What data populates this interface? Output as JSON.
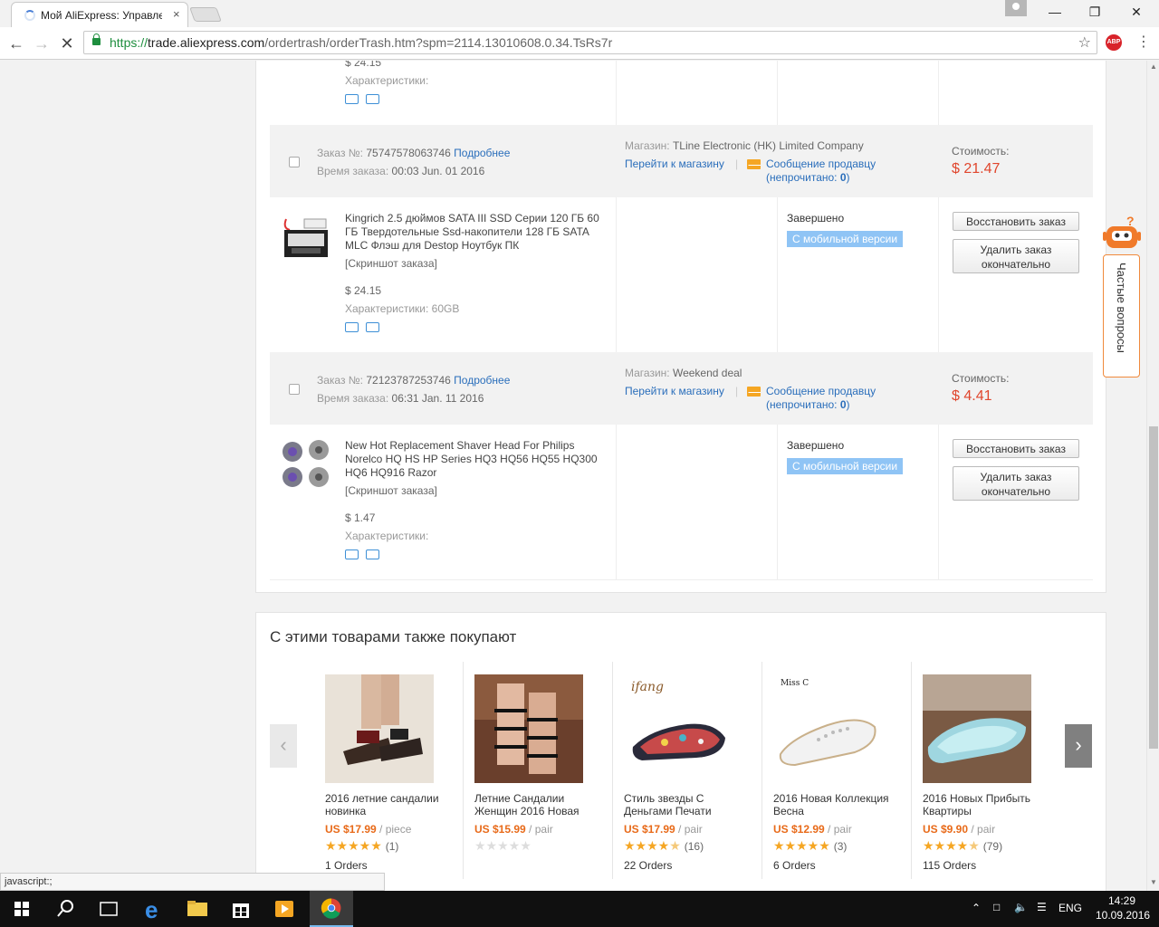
{
  "browser": {
    "tab_title": "Мой AliExpress: Управле",
    "tab_close": "×",
    "url_scheme": "https://",
    "url_host": "trade.aliexpress.com",
    "url_path": "/ordertrash/orderTrash.htm?spm=2114.13010608.0.34.TsRs7r",
    "abp_label": "ABP",
    "status_text": "javascript:;"
  },
  "orders": {
    "prev_item": {
      "price": "$ 24.15",
      "attr_label": "Характеристики:"
    },
    "list": [
      {
        "order_label": "Заказ №:",
        "order_no": "75747578063746",
        "details_link": "Подробнее",
        "time_label": "Время заказа:",
        "time": "00:03 Jun. 01 2016",
        "store_label": "Магазин:",
        "store": "TLine Electronic (HK) Limited Company",
        "store_link": "Перейти к магазину",
        "msg_link": "Сообщение продавцу",
        "unread_open": "(непрочитано: ",
        "unread": "0",
        "unread_close": ")",
        "cost_label": "Стоимость:",
        "cost": "$ 21.47",
        "item": {
          "title": "Kingrich 2.5 дюймов SATA III SSD Серии 120 ГБ 60 ГБ Твердотельные Ssd-накопители 128 ГБ SATA MLC Флэш для Destop Ноутбук ПК",
          "screenshot": "[Скриншот заказа]",
          "price": "$ 24.15",
          "attr": "Характеристики: 60GB",
          "status": "Завершено",
          "badge": "С мобильной версии",
          "restore": "Восстановить заказ",
          "delete": "Удалить заказ окончательно"
        }
      },
      {
        "order_label": "Заказ №:",
        "order_no": "72123787253746",
        "details_link": "Подробнее",
        "time_label": "Время заказа:",
        "time": "06:31 Jan. 11 2016",
        "store_label": "Магазин:",
        "store": "Weekend deal",
        "store_link": "Перейти к магазину",
        "msg_link": "Сообщение продавцу",
        "unread_open": "(непрочитано: ",
        "unread": "0",
        "unread_close": ")",
        "cost_label": "Стоимость:",
        "cost": "$ 4.41",
        "item": {
          "title": "New Hot Replacement Shaver Head For Philips Norelco HQ HS HP Series HQ3 HQ56 HQ55 HQ300 HQ6 HQ916 Razor",
          "screenshot": "[Скриншот заказа]",
          "price": "$ 1.47",
          "attr": "Характеристики:",
          "status": "Завершено",
          "badge": "С мобильной версии",
          "restore": "Восстановить заказ",
          "delete": "Удалить заказ окончательно"
        }
      }
    ]
  },
  "reco": {
    "title": "С этими товарами также покупают",
    "items": [
      {
        "name": "2016 летние сандалии новинка",
        "price": "US $17.99",
        "unit": " / piece",
        "rating": 5,
        "reviews": "(1)",
        "orders": "1 Orders"
      },
      {
        "name": "Летние Сандалии Женщин 2016 Новая",
        "price": "US $15.99",
        "unit": " / pair",
        "rating": 0,
        "reviews": "",
        "orders": ""
      },
      {
        "name": "Стиль звезды С Деньгами Печати",
        "price": "US $17.99",
        "unit": " / pair",
        "rating": 4.5,
        "reviews": "(16)",
        "orders": "22 Orders",
        "brand": "ifang"
      },
      {
        "name": "2016 Новая Коллекция Весна",
        "price": "US $12.99",
        "unit": " / pair",
        "rating": 5,
        "reviews": "(3)",
        "orders": "6 Orders",
        "brand": "Miss C"
      },
      {
        "name": "2016 Новых Прибыть Квартиры",
        "price": "US $9.90",
        "unit": " / pair",
        "rating": 4.5,
        "reviews": "(79)",
        "orders": "115 Orders"
      }
    ]
  },
  "faq": {
    "label": "Частые вопросы",
    "badge": "?"
  },
  "taskbar": {
    "lang": "ENG",
    "time": "14:29",
    "date": "10.09.2016"
  }
}
